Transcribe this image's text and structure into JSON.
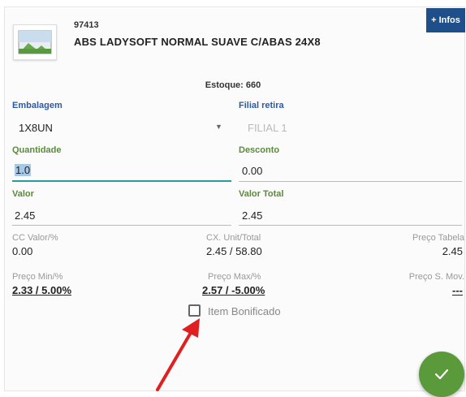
{
  "product": {
    "code": "97413",
    "name": "ABS LADYSOFT NORMAL SUAVE C/ABAS 24X8"
  },
  "infos_button": "+ Infos",
  "stock": "Estoque: 660",
  "embalagem": {
    "label": "Embalagem",
    "value": "1X8UN"
  },
  "filial": {
    "label": "Filial retira",
    "value": "FILIAL 1"
  },
  "quantidade": {
    "label": "Quantidade",
    "value": "1.0"
  },
  "desconto": {
    "label": "Desconto",
    "value": "0.00"
  },
  "valor": {
    "label": "Valor",
    "value": "2.45"
  },
  "valor_total": {
    "label": "Valor Total",
    "value": "2.45"
  },
  "cc_valor": {
    "label": "CC Valor/%",
    "value": "0.00"
  },
  "cx_unit": {
    "label": "CX. Unit/Total",
    "value": "2.45 / 58.80"
  },
  "preco_tabela": {
    "label": "Preço Tabela",
    "value": "2.45"
  },
  "preco_min": {
    "label": "Preço Min/%",
    "value": "2.33 / 5.00%"
  },
  "preco_max": {
    "label": "Preço Max/%",
    "value": "2.57 / -5.00%"
  },
  "preco_smov": {
    "label": "Preço S. Mov.",
    "value": "---"
  },
  "item_bonificado": {
    "label": "Item Bonificado",
    "checked": false
  },
  "colors": {
    "accent_blue": "#1e4f8a",
    "label_blue": "#2c5aa0",
    "label_green": "#5a8a3a",
    "fab_green": "#5a9a3a",
    "arrow_red": "#e02020"
  },
  "icons": {
    "product_thumbnail": "image-placeholder-icon",
    "dropdown": "triangle-down-icon",
    "confirm": "checkmark-icon",
    "annotation": "red-arrow-icon"
  }
}
